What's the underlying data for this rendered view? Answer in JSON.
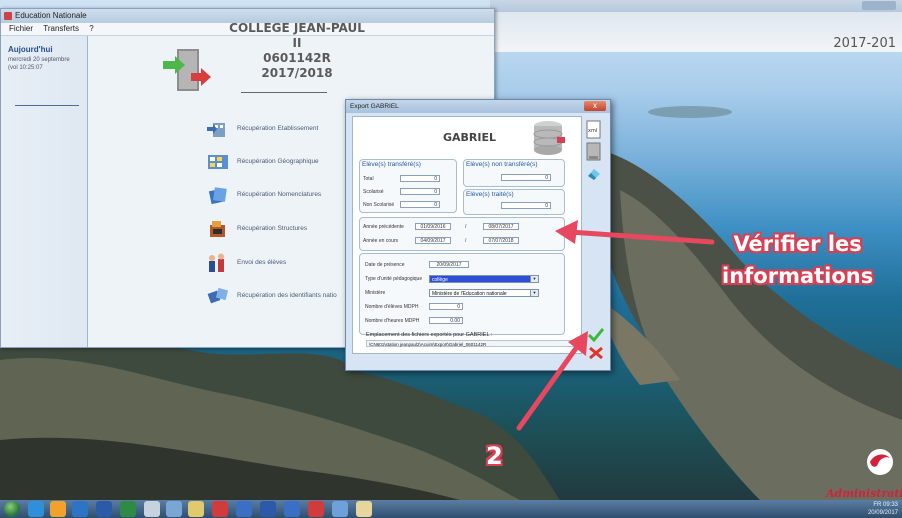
{
  "app": {
    "title": "Education Nationale",
    "menu": [
      "Fichier",
      "Transferts",
      "?"
    ],
    "today": {
      "title": "Aujourd'hui",
      "date": "mercredi 20 septembre",
      "time": "(vol 10:25:07"
    },
    "school": {
      "name": "COLLEGE JEAN-PAUL II",
      "code": "0601142R",
      "year": "2017/2018"
    },
    "menu_items": [
      {
        "label": "Récupération Etablissement",
        "icon": "building-arrow-icon"
      },
      {
        "label": "Récupération Géographique",
        "icon": "map-grid-icon"
      },
      {
        "label": "Récupération Nomenclatures",
        "icon": "documents-icon"
      },
      {
        "label": "Récupération Structures",
        "icon": "structure-icon"
      },
      {
        "label": "Envoi des élèves",
        "icon": "students-send-icon"
      },
      {
        "label": "Récupération des identifiants natio",
        "icon": "identifiers-icon"
      }
    ]
  },
  "background_window": {
    "year": "2017-201"
  },
  "dialog": {
    "title": "Export GABRIEL",
    "close": "x",
    "name": "GABRIEL",
    "transferred": {
      "title": "Elève(s) transféré(s)",
      "fields": [
        {
          "label": "Total",
          "value": "0"
        },
        {
          "label": "Scolarisé",
          "value": "0"
        },
        {
          "label": "Non Scolarisé",
          "value": "0"
        }
      ]
    },
    "not_transferred": {
      "title": "Elève(s) non transféré(s)",
      "value": "0"
    },
    "processed": {
      "title": "Elève(s) traité(s)",
      "value": "0"
    },
    "years": [
      {
        "label": "Année précédente",
        "start": "01/09/2016",
        "sep": "/",
        "end": "08/07/2017"
      },
      {
        "label": "Année en cours",
        "start": "04/09/2017",
        "sep": "/",
        "end": "07/07/2018"
      }
    ],
    "presence": {
      "label": "Date de présence",
      "value": "20/09/2017"
    },
    "unit_type": {
      "label": "Type d'unité pédagogique",
      "value": "collège"
    },
    "ministry": {
      "label": "Ministère",
      "value": "Ministère de l'Education nationale"
    },
    "mdph_students": {
      "label": "Nombre d'élèves MDPH",
      "value": "0"
    },
    "mdph_hours": {
      "label": "Nombre d'heures MDPH",
      "value": "0.00"
    },
    "export_path_label": "Emplacement des fichiers exportés pour GABRIEL :",
    "export_path": "\\CN601\\station jeanpaul2\\Acuim\\Export\\Gabriel_0601142R",
    "side_buttons": [
      "xml-file-icon",
      "file-icon",
      "eraser-icon"
    ]
  },
  "annotations": {
    "verify_line1": "Vérifier les",
    "verify_line2": "informations",
    "step": "2"
  },
  "logo": {
    "text": "Administrati"
  },
  "taskbar": {
    "time": "09:33",
    "date": "20/09/2017",
    "lang": "FR"
  },
  "colors": {
    "accent": "#d93f53",
    "title_blue": "#2458a6",
    "ok": "#3db83b",
    "cancel": "#e0342a"
  }
}
